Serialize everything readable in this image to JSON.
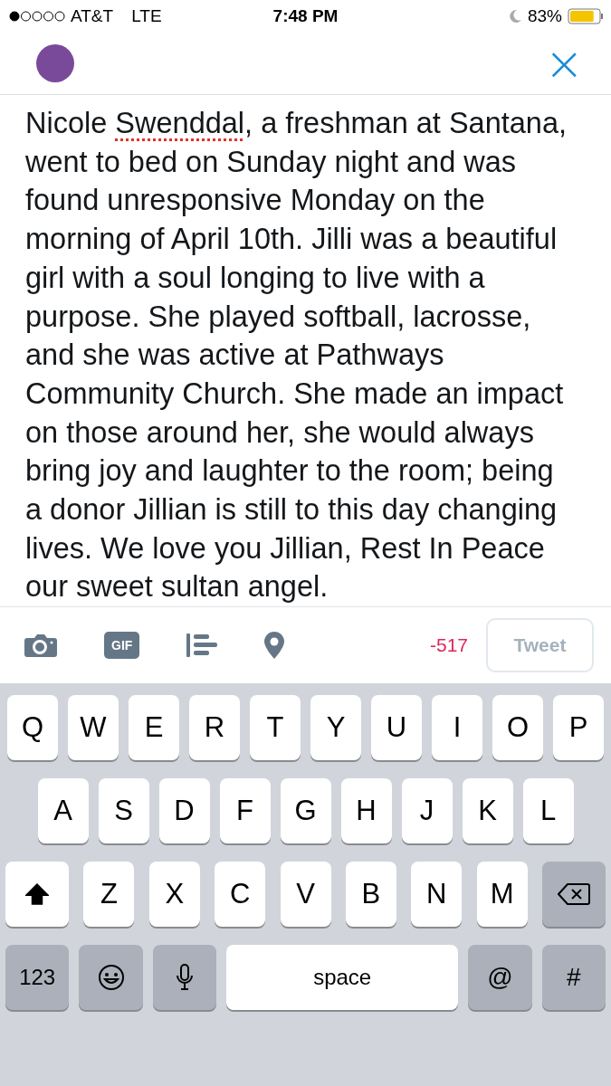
{
  "status_bar": {
    "carrier": "AT&T",
    "network": "LTE",
    "time": "7:48 PM",
    "battery": "83%",
    "do_not_disturb": true
  },
  "header": {
    "close": "×"
  },
  "text": [
    {
      "text": "Nicole ",
      "misspelled": false
    },
    {
      "text": "Swenddal",
      "misspelled": true
    },
    {
      "text": ", a freshman at Santana, went to bed on Sunday night and was found unresponsive Monday on the morning of April 10th. Jilli was a beautiful girl with a soul longing to live with a purpose. She played softball, lacrosse, and she was active at Pathways  Community Church. She made an impact on those around her, she would always bring joy and laughter to the room; being a donor Jillian is still to this day changing lives. We love you Jillian, Rest In Peace our sweet sultan angel.",
      "misspelled": false
    }
  ],
  "toolbar": {
    "gif": "GIF",
    "counter": "-517",
    "tweet": {
      "label": "Tweet",
      "disabled": true
    }
  },
  "keyboard": [
    [
      {
        "label": "Q",
        "kind": "letter"
      },
      {
        "label": "W",
        "kind": "letter"
      },
      {
        "label": "E",
        "kind": "letter"
      },
      {
        "label": "R",
        "kind": "letter"
      },
      {
        "label": "T",
        "kind": "letter"
      },
      {
        "label": "Y",
        "kind": "letter"
      },
      {
        "label": "U",
        "kind": "letter"
      },
      {
        "label": "I",
        "kind": "letter"
      },
      {
        "label": "O",
        "kind": "letter"
      },
      {
        "label": "P",
        "kind": "letter"
      }
    ],
    [
      {
        "label": "A",
        "kind": "letter"
      },
      {
        "label": "S",
        "kind": "letter"
      },
      {
        "label": "D",
        "kind": "letter"
      },
      {
        "label": "F",
        "kind": "letter"
      },
      {
        "label": "G",
        "kind": "letter"
      },
      {
        "label": "H",
        "kind": "letter"
      },
      {
        "label": "J",
        "kind": "letter"
      },
      {
        "label": "K",
        "kind": "letter"
      },
      {
        "label": "L",
        "kind": "letter"
      }
    ],
    [
      {
        "kind": "shift",
        "on": true
      },
      {
        "label": "Z",
        "kind": "letter"
      },
      {
        "label": "X",
        "kind": "letter"
      },
      {
        "label": "C",
        "kind": "letter"
      },
      {
        "label": "V",
        "kind": "letter"
      },
      {
        "label": "B",
        "kind": "letter"
      },
      {
        "label": "N",
        "kind": "letter"
      },
      {
        "label": "M",
        "kind": "letter"
      },
      {
        "kind": "delete"
      }
    ],
    [
      {
        "label": "123",
        "kind": "mode"
      },
      {
        "kind": "emoji"
      },
      {
        "kind": "mic"
      },
      {
        "label": "space",
        "kind": "space"
      },
      {
        "label": "@",
        "kind": "symbol"
      },
      {
        "label": "#",
        "kind": "symbol"
      }
    ]
  ]
}
